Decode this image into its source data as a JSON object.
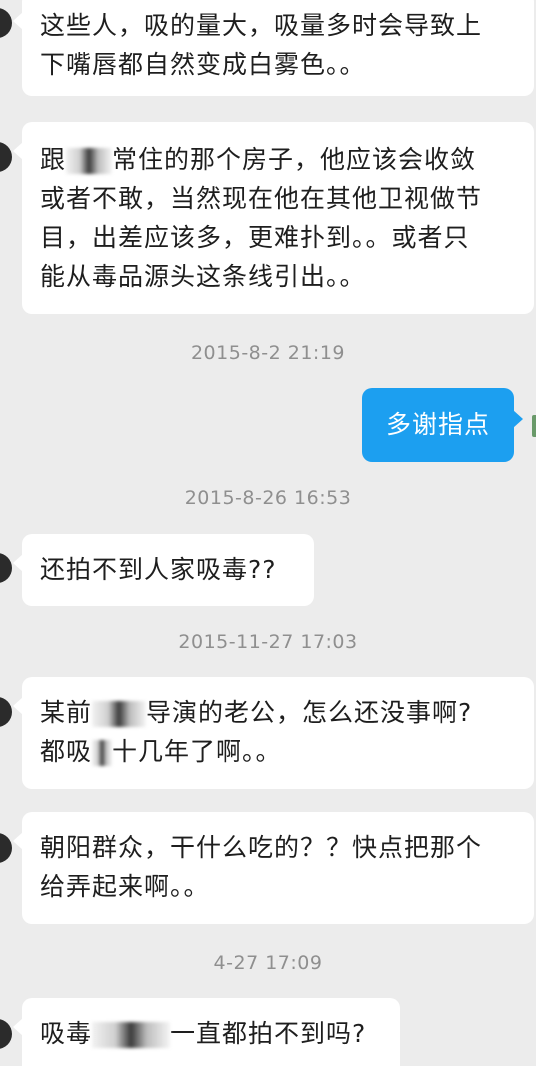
{
  "chat": {
    "msg1": {
      "line1": "这些人，吸的量大，吸量多时会导致上",
      "line2": "下嘴唇都自然变成白雾色。。"
    },
    "msg2": {
      "line1_pre": "跟",
      "line1_post": "常住的那个房子，他应该会收敛",
      "line2": "或者不敢，当然现在他在其他卫视做节",
      "line3": "目，出差应该多，更难扑到。。或者只",
      "line4": "能从毒品源头这条线引出。。"
    },
    "ts1": "2015-8-2 21:19",
    "msg3": "多谢指点",
    "ts2": "2015-8-26 16:53",
    "msg4": "还拍不到人家吸毒??",
    "ts3": "2015-11-27 17:03",
    "msg5": {
      "line1_pre": "某前",
      "line1_post": "导演的老公，怎么还没事啊?",
      "line2_pre": "都吸",
      "line2_post": "十几年了啊。。"
    },
    "msg6": {
      "line1": "朝阳群众，干什么吃的？？快点把那个",
      "line2": "给弄起来啊。。"
    },
    "ts4": "4-27 17:09",
    "msg7": {
      "pre": "吸毒",
      "post": "一直都拍不到吗?"
    }
  }
}
